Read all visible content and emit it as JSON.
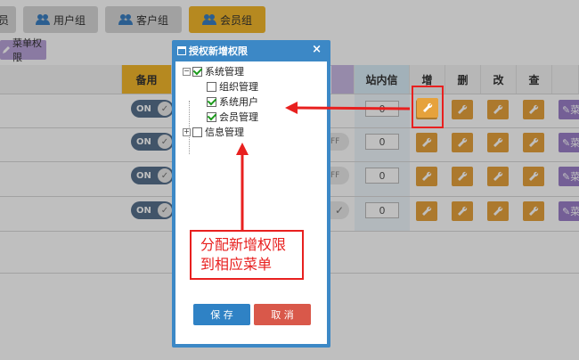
{
  "tabs": [
    {
      "label": "员",
      "icon": "users-icon"
    },
    {
      "label": "用户组",
      "icon": "users-icon"
    },
    {
      "label": "客户组",
      "icon": "users-icon"
    },
    {
      "label": "会员组",
      "icon": "users-icon"
    }
  ],
  "menu_perm_label": "菜单权限",
  "table": {
    "headers": {
      "backup": "备用",
      "inbox": "站内信",
      "add": "增",
      "delete": "删",
      "edit": "改",
      "query": "查"
    },
    "rows": [
      {
        "toggle": "ON",
        "value": "0",
        "edit_label": "菜"
      },
      {
        "toggle": "ON",
        "value": "0",
        "edit_label": "菜"
      },
      {
        "toggle": "ON",
        "value": "0",
        "edit_label": "菜"
      },
      {
        "toggle": "ON",
        "value": "0",
        "edit_label": "菜"
      }
    ],
    "off_label": "FF"
  },
  "dialog": {
    "title": "授权新增权限",
    "close": "×",
    "tree": [
      {
        "label": "系统管理",
        "checked": true,
        "level": 0,
        "expanded": true
      },
      {
        "label": "组织管理",
        "checked": false,
        "level": 1
      },
      {
        "label": "系统用户",
        "checked": true,
        "level": 1
      },
      {
        "label": "会员管理",
        "checked": true,
        "level": 1
      },
      {
        "label": "信息管理",
        "checked": false,
        "level": 0,
        "expanded": false
      }
    ],
    "save_label": "保 存",
    "cancel_label": "取 消"
  },
  "annotation": {
    "line1": "分配新增权限",
    "line2": "到相应菜单",
    "color": "#e8201f"
  },
  "colors": {
    "accent": "#f3b72b",
    "dialog": "#3c88c6",
    "save": "#2f82c5",
    "cancel": "#d9584a"
  }
}
